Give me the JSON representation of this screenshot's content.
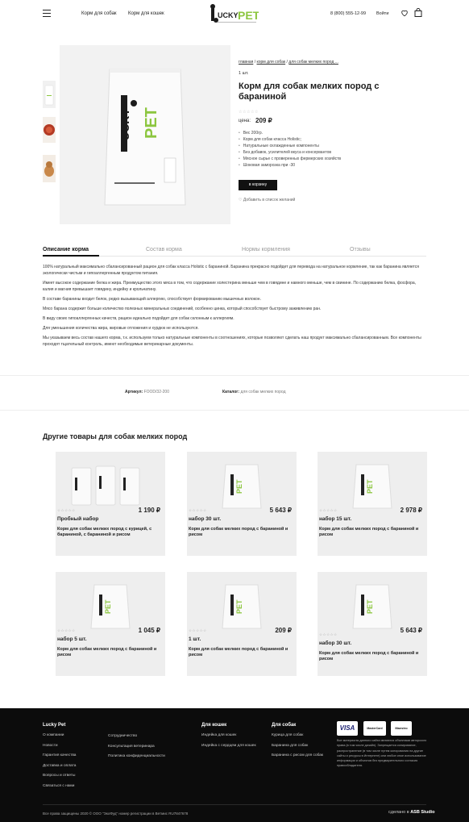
{
  "header": {
    "nav": [
      "Корм для собак",
      "Корм для кошек"
    ],
    "logo_text": "LUCKY PET",
    "phone": "8 (800) 555-12-99",
    "login": "Войти"
  },
  "product": {
    "breadcrumb": [
      "главная",
      "корм для собак",
      "для собак мелких пород ..."
    ],
    "qty": "1 шт.",
    "title": "Корм для собак мелких пород с бараниной",
    "stars": "☆☆☆☆☆",
    "price_label": "цена:",
    "price": "209 ₽",
    "features": [
      "Вес 200гр.",
      "Корм для собак класса Holistic;",
      "Натуральные охлажденные компоненты",
      "Без добавок, усилителей вкуса и консервантов",
      "Мясное сырье с проверенных фермерских хозяйств",
      "Шоковая заморозка при -30"
    ],
    "cart_button": "в корзину",
    "wishlist": "Добавить в список желаний"
  },
  "tabs": [
    "Описание корма",
    "Состав корма",
    "Нормы кормления",
    "Отзывы"
  ],
  "description": [
    "100% натуральный максимально сбалансированный рацион для собак класса Holistic с бараниной. Баранина прекрасно подойдет для перевода на натуральное кормление, так как баранина является экологически чистым и гипоаллергенным продуктом питания.",
    "Имеет высокое содержание белка и жира. Преимущество этого мяса в том, что содержание холестерина меньше чем в говядине и намного меньше, чем в свинине. По содержанию белка, фосфора, калия и магния превышает говядину, индейку и крольчатину.",
    "В составе баранины входит белок, редко вызывающий аллергию, способствует формированию мышечных волокон.",
    "Мясо барана содержит больше количество полезных минеральных соединений, особенно цинка, который способствует быстрому заживлению ран.",
    "В виду своих гипоаллергенных качеств, рацион идеально подойдет для собак склонным к аллергиям.",
    "Для уменьшения количества жира, жировые отложения и хурдюк не используются.",
    "Мы указываем весь состав нашего корма, т.к. используем только натуральные компоненты в соотношениях, которые позволяют сделать наш продукт максимально сбалансированным. Все компоненты проходят тщательный контроль, имеют необходимые ветеринарные документы."
  ],
  "meta": {
    "sku_label": "Артикул:",
    "sku": "FOOD/32-200",
    "catalog_label": "Каталог:",
    "catalog": "для собак мелких пород"
  },
  "related_title": "Другие товары для собак мелких пород",
  "related": [
    {
      "stars": "☆☆☆☆☆",
      "price": "1 190 ₽",
      "qty": "Пробный набор",
      "name": "Корм для собак мелких пород с курицей, с бараниной, с бараниной и рисом"
    },
    {
      "stars": "☆☆☆☆☆",
      "price": "5 643 ₽",
      "qty": "набор 30 шт.",
      "name": "Корм для собак мелких пород с бараниной и рисом"
    },
    {
      "stars": "☆☆☆☆☆",
      "price": "2 978 ₽",
      "qty": "набор 15 шт.",
      "name": "Корм для собак мелких пород с бараниной и рисом"
    },
    {
      "stars": "☆☆☆☆☆",
      "price": "1 045 ₽",
      "qty": "набор 5 шт.",
      "name": "Корм для собак мелких пород с бараниной и рисом"
    },
    {
      "stars": "☆☆☆☆☆",
      "price": "209 ₽",
      "qty": "1 шт.",
      "name": "Корм для собак мелких пород с бараниной и рисом"
    },
    {
      "stars": "☆☆☆☆☆",
      "price": "5 643 ₽",
      "qty": "набор 30 шт.",
      "name": "Корм для собак мелких пород с бараниной и рисом"
    }
  ],
  "footer": {
    "brand": "Lucky Pet",
    "col1": [
      "О компании",
      "Новости",
      "Гарантия качества",
      "Доставка и оплата",
      "Вопросы и ответы",
      "Связаться с нами"
    ],
    "col2": [
      "Сотрудничество",
      "Консультация ветеринара",
      "Политика конфиденциальности"
    ],
    "cats_head": "Для кошек",
    "cats": [
      "Индейка для кошек",
      "Индейка с сердцем для кошек"
    ],
    "dogs_head": "Для собак",
    "dogs": [
      "Курица для собак",
      "Баранина для собак",
      "Баранина с рисом для собак"
    ],
    "payments": [
      "VISA",
      "MasterCard",
      "Maestro"
    ],
    "note": "Все материалы данного сайта являются объектами авторского права (в том числе дизайн). Запрещается копирование, распространение (в том числе путем копирования на другие сайты и ресурсы в Интернете) или любое иное использование информации и объектов без предварительного согласия правообладателя.",
    "copyright": "Все права защищены 2020 © ООО \"ЭкоФуд\" номер регистрации в Ветмис RU7847678",
    "made_by": "сделано в",
    "studio": "ASB Studio"
  }
}
